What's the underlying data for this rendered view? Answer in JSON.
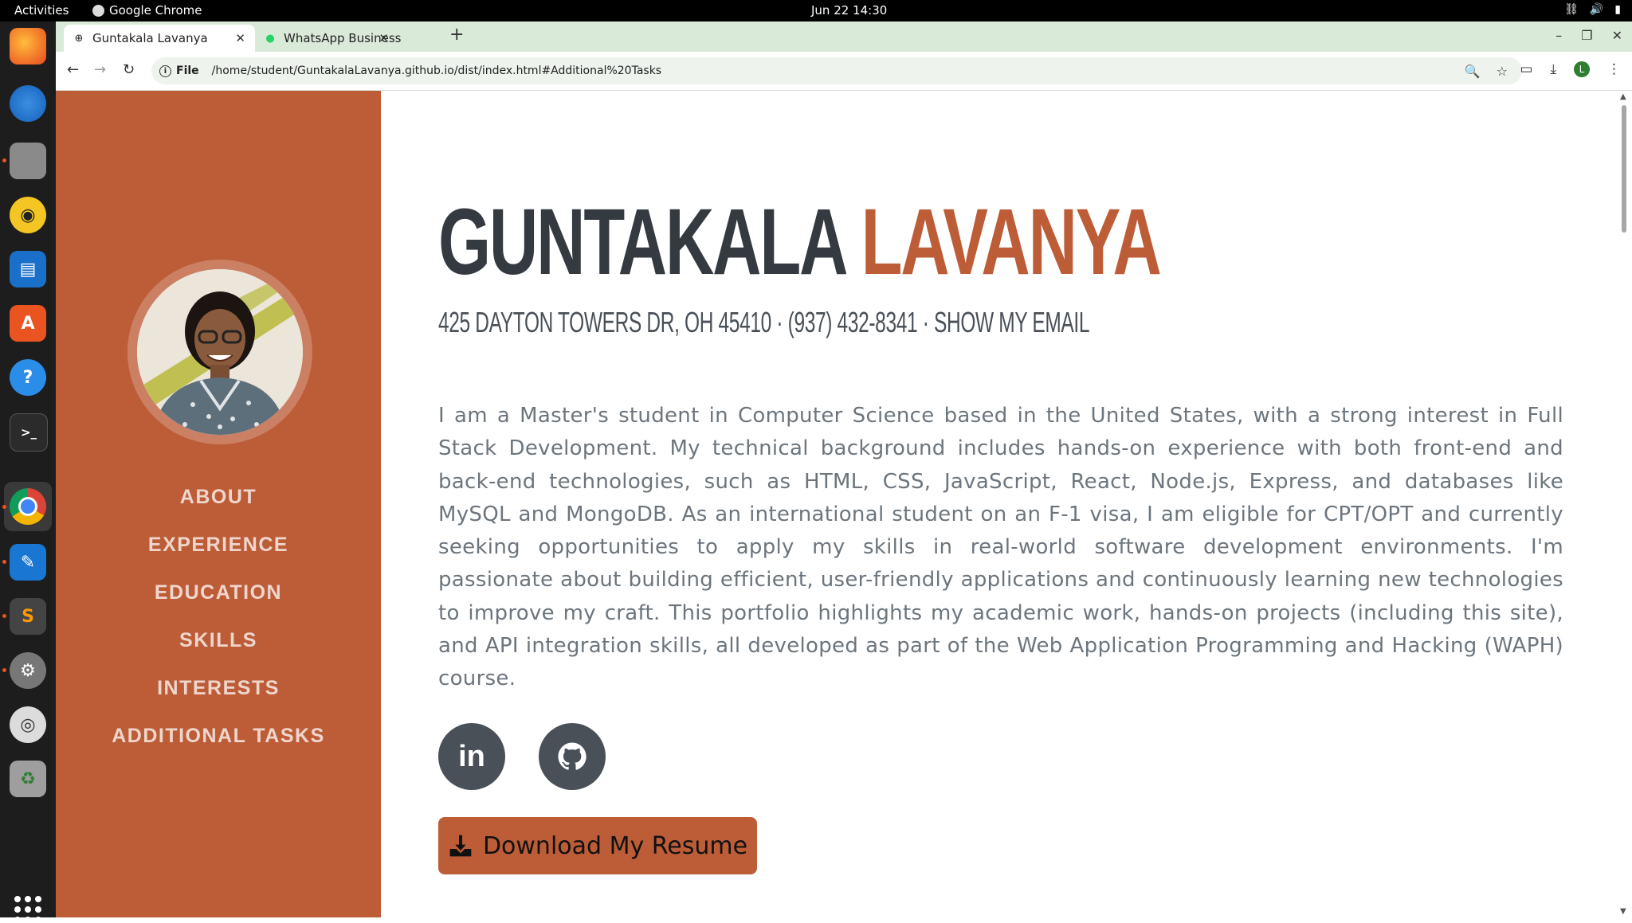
{
  "system": {
    "activities": "Activities",
    "app_name": "Google Chrome",
    "clock": "Jun 22  14:30"
  },
  "browser": {
    "tabs": [
      {
        "title": "Guntakala Lavanya",
        "active": true
      },
      {
        "title": "WhatsApp Business",
        "active": false
      }
    ],
    "url_scheme_label": "File",
    "url": "/home/student/GuntakalaLavanya.github.io/dist/index.html#Additional%20Tasks",
    "profile_initial": "L"
  },
  "sidebar": {
    "nav": [
      "ABOUT",
      "EXPERIENCE",
      "EDUCATION",
      "SKILLS",
      "INTERESTS",
      "ADDITIONAL TASKS"
    ]
  },
  "about": {
    "first_name": "GUNTAKALA",
    "last_name": "LAVANYA",
    "address": "425 DAYTON TOWERS DR, OH 45410 · (937) 432-8341 · ",
    "email_link": "SHOW MY EMAIL",
    "bio": "I am a Master's student in Computer Science based in the United States, with a strong interest in Full Stack Development. My technical background includes hands-on experience with both front-end and back-end technologies, such as HTML, CSS, JavaScript, React, Node.js, Express, and databases like MySQL and MongoDB. As an international student on an F-1 visa, I am eligible for CPT/OPT and currently seeking opportunities to apply my skills in real-world software development environments. I'm passionate about building efficient, user-friendly applications and continuously learning new technologies to improve my craft. This portfolio highlights my academic work, hands-on projects (including this site), and API integration skills, all developed as part of the Web Application Programming and Hacking (WAPH) course.",
    "social": [
      {
        "icon": "linkedin-icon"
      },
      {
        "icon": "github-icon"
      }
    ],
    "resume_button": "Download My Resume"
  },
  "colors": {
    "accent": "#bd5d38",
    "heading": "#343a40",
    "text": "#6c757d",
    "social_bg": "#495057"
  }
}
